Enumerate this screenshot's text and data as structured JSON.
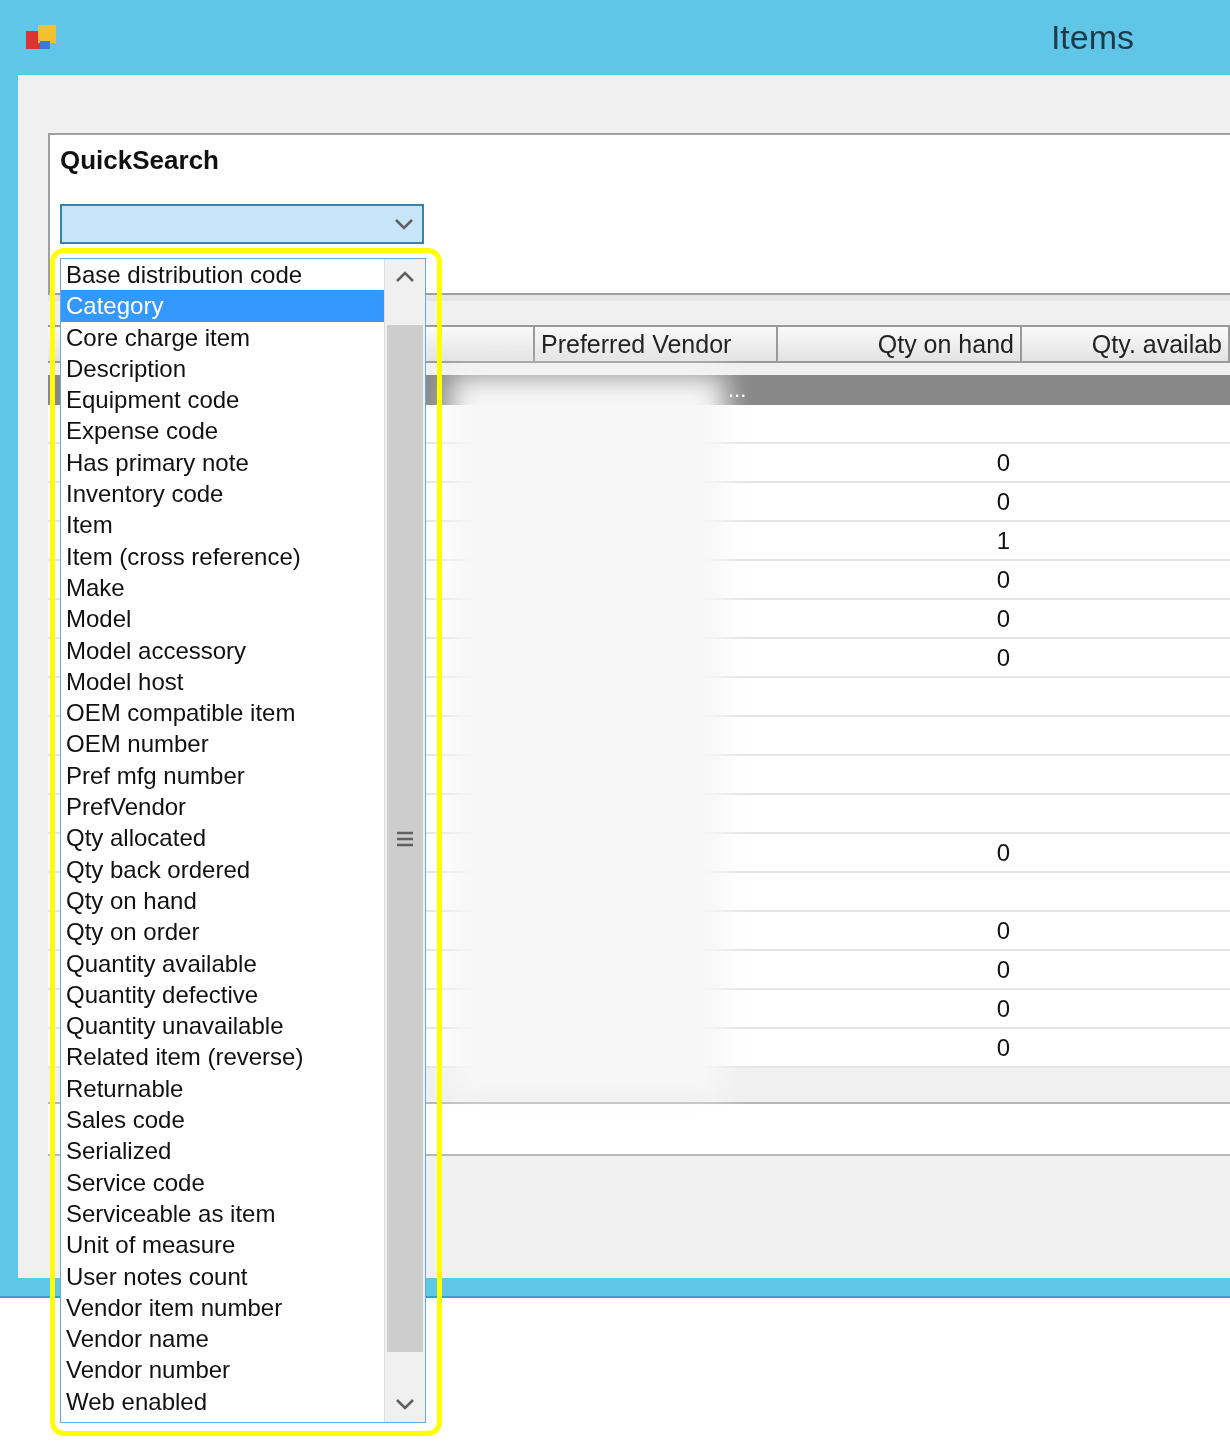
{
  "window": {
    "title": "Items"
  },
  "quick_search": {
    "label": "QuickSearch",
    "dropdown": {
      "expanded": true,
      "items": [
        {
          "label": "Base distribution code",
          "selected": false
        },
        {
          "label": "Category",
          "selected": true
        },
        {
          "label": "Core charge item",
          "selected": false
        },
        {
          "label": "Description",
          "selected": false
        },
        {
          "label": "Equipment code",
          "selected": false
        },
        {
          "label": "Expense code",
          "selected": false
        },
        {
          "label": "Has primary note",
          "selected": false
        },
        {
          "label": "Inventory code",
          "selected": false
        },
        {
          "label": "Item",
          "selected": false
        },
        {
          "label": "Item (cross reference)",
          "selected": false
        },
        {
          "label": "Make",
          "selected": false
        },
        {
          "label": "Model",
          "selected": false
        },
        {
          "label": "Model accessory",
          "selected": false
        },
        {
          "label": "Model host",
          "selected": false
        },
        {
          "label": "OEM compatible item",
          "selected": false
        },
        {
          "label": "OEM number",
          "selected": false
        },
        {
          "label": "Pref mfg number",
          "selected": false
        },
        {
          "label": "PrefVendor",
          "selected": false
        },
        {
          "label": "Qty allocated",
          "selected": false
        },
        {
          "label": "Qty back ordered",
          "selected": false
        },
        {
          "label": "Qty on hand",
          "selected": false
        },
        {
          "label": "Qty on order",
          "selected": false
        },
        {
          "label": "Quantity available",
          "selected": false
        },
        {
          "label": "Quantity defective",
          "selected": false
        },
        {
          "label": "Quantity unavailable",
          "selected": false
        },
        {
          "label": "Related item (reverse)",
          "selected": false
        },
        {
          "label": "Returnable",
          "selected": false
        },
        {
          "label": "Sales code",
          "selected": false
        },
        {
          "label": "Serialized",
          "selected": false
        },
        {
          "label": "Service code",
          "selected": false
        },
        {
          "label": "Serviceable as item",
          "selected": false
        },
        {
          "label": "Unit of measure",
          "selected": false
        },
        {
          "label": "User notes count",
          "selected": false
        },
        {
          "label": "Vendor item number",
          "selected": false
        },
        {
          "label": "Vendor name",
          "selected": false
        },
        {
          "label": "Vendor number",
          "selected": false
        },
        {
          "label": "Web enabled",
          "selected": false
        }
      ]
    }
  },
  "table": {
    "columns": [
      "Preferred Vendor",
      "Qty on hand",
      "Qty. availab"
    ],
    "rows": [
      {
        "kind": "group",
        "text": "..."
      },
      {
        "kind": "data"
      },
      {
        "kind": "data",
        "qty_on_hand": "0"
      },
      {
        "kind": "data",
        "qty_on_hand": "0"
      },
      {
        "kind": "data",
        "qty_on_hand": "1"
      },
      {
        "kind": "data",
        "qty_on_hand": "0"
      },
      {
        "kind": "data",
        "qty_on_hand": "0"
      },
      {
        "kind": "data",
        "qty_on_hand": "0"
      },
      {
        "kind": "data"
      },
      {
        "kind": "data"
      },
      {
        "kind": "data"
      },
      {
        "kind": "data"
      },
      {
        "kind": "data",
        "qty_on_hand": "0"
      },
      {
        "kind": "data"
      },
      {
        "kind": "data",
        "qty_on_hand": "0"
      },
      {
        "kind": "data",
        "qty_on_hand": "0"
      },
      {
        "kind": "data",
        "qty_on_hand": "0"
      },
      {
        "kind": "data",
        "qty_on_hand": "0"
      }
    ]
  }
}
